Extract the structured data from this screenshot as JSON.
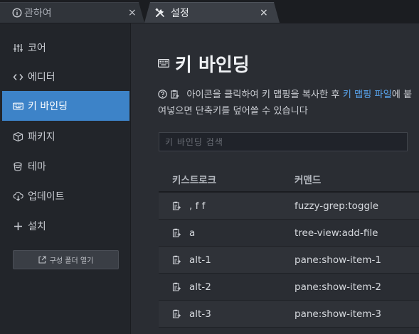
{
  "tabs": [
    {
      "label": "관하여",
      "icon": "info-icon",
      "close": "×",
      "active": false
    },
    {
      "label": "설정",
      "icon": "tools-icon",
      "close": "×",
      "active": true
    }
  ],
  "sidebar": {
    "items": [
      {
        "label": "코어",
        "icon": "sliders-icon",
        "active": false
      },
      {
        "label": "에디터",
        "icon": "code-icon",
        "active": false
      },
      {
        "label": "키 바인딩",
        "icon": "keyboard-icon",
        "active": true
      },
      {
        "label": "패키지",
        "icon": "package-icon",
        "active": false
      },
      {
        "label": "테마",
        "icon": "paintcan-icon",
        "active": false
      },
      {
        "label": "업데이트",
        "icon": "cloud-download-icon",
        "active": false
      },
      {
        "label": "설치",
        "icon": "plus-icon",
        "active": false
      }
    ],
    "config_button": {
      "label": "구성 폴더 열기",
      "icon": "link-external-icon"
    }
  },
  "main": {
    "title": "키 바인딩",
    "description": {
      "before": "아이콘을 클릭하여 키 맵핑을 복사한 후 ",
      "link": "키 맵핑 파일",
      "after": "에 붙여넣으면 단축키를 덮어쓸 수 있습니다"
    },
    "search": {
      "placeholder": "키 바인딩 검색",
      "value": ""
    },
    "table": {
      "headers": {
        "keystroke": "키스트로크",
        "command": "커맨드"
      },
      "rows": [
        {
          "keystroke": ", f f",
          "command": "fuzzy-grep:toggle"
        },
        {
          "keystroke": "a",
          "command": "tree-view:add-file"
        },
        {
          "keystroke": "alt-1",
          "command": "pane:show-item-1"
        },
        {
          "keystroke": "alt-2",
          "command": "pane:show-item-2"
        },
        {
          "keystroke": "alt-3",
          "command": "pane:show-item-3"
        }
      ]
    }
  },
  "colors": {
    "accent": "#3d83c8",
    "link": "#5aa6f0",
    "background": "#2a2d33",
    "sidebar": "#22252a"
  }
}
